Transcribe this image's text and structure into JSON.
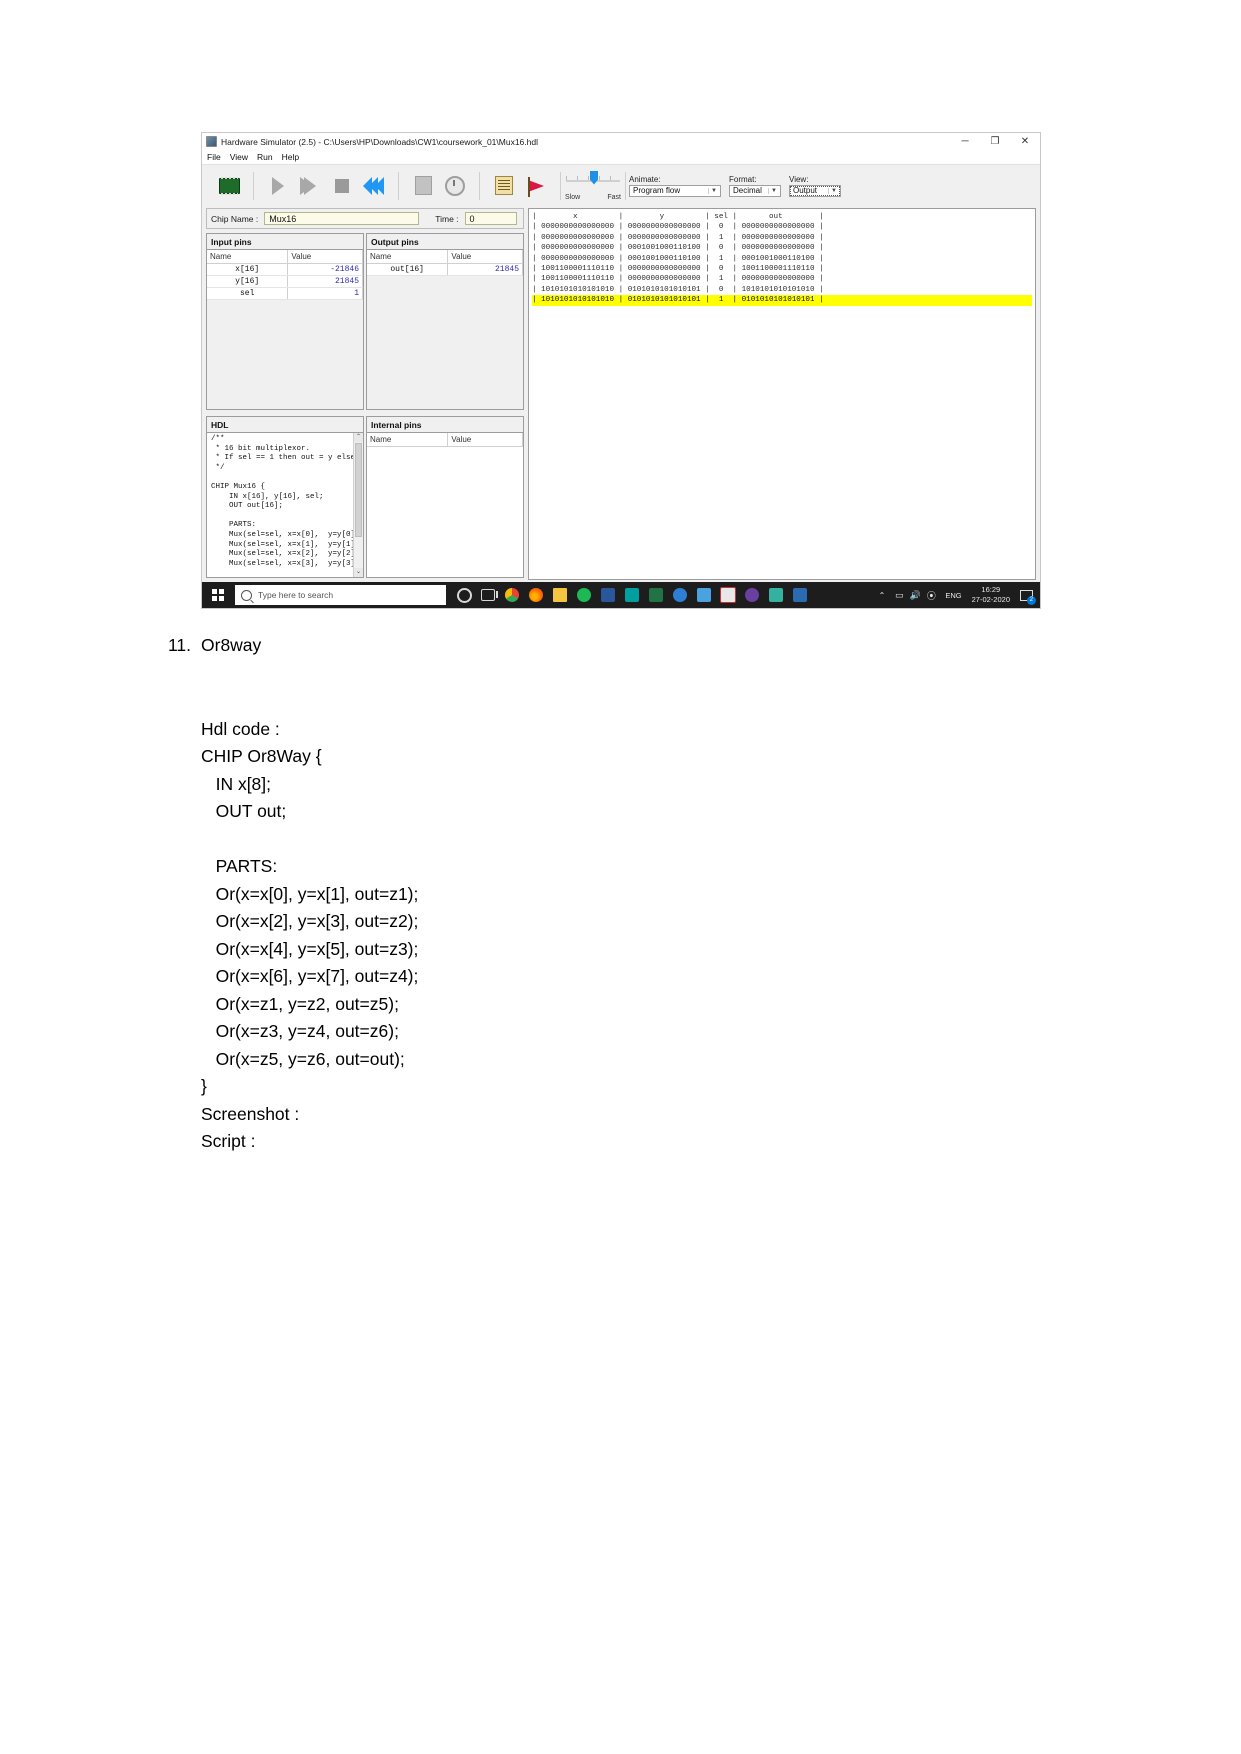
{
  "window": {
    "title": "Hardware Simulator (2.5) - C:\\Users\\HP\\Downloads\\CW1\\coursework_01\\Mux16.hdl",
    "icon": "chip-icon",
    "minimize": "─",
    "maximize": "❐",
    "close": "✕",
    "menus": [
      "File",
      "View",
      "Run",
      "Help"
    ]
  },
  "toolbar": {
    "buttons": [
      {
        "name": "load-chip-icon",
        "label": "Load Chip"
      },
      {
        "name": "single-step-icon",
        "label": "Single Step"
      },
      {
        "name": "run-icon",
        "label": "Run"
      },
      {
        "name": "stop-icon",
        "label": "Stop"
      },
      {
        "name": "rewind-icon",
        "label": "Rewind"
      },
      {
        "name": "load-script-icon",
        "label": "Load Script"
      },
      {
        "name": "clock-icon",
        "label": "Clock"
      },
      {
        "name": "script-icon",
        "label": "Script"
      },
      {
        "name": "breakpoints-icon",
        "label": "Breakpoints"
      }
    ],
    "speed": {
      "slow_label": "Slow",
      "fast_label": "Fast",
      "position_percent": 50
    },
    "animate": {
      "label": "Animate:",
      "value": "Program flow"
    },
    "format": {
      "label": "Format:",
      "value": "Decimal"
    },
    "view": {
      "label": "View:",
      "value": "Output"
    }
  },
  "chip": {
    "name_label": "Chip Name :",
    "name_value": "Mux16",
    "time_label": "Time :",
    "time_value": "0"
  },
  "input_pins": {
    "title": "Input pins",
    "columns": [
      "Name",
      "Value"
    ],
    "rows": [
      {
        "name": "x[16]",
        "value": "-21846"
      },
      {
        "name": "y[16]",
        "value": "21845"
      },
      {
        "name": "sel",
        "value": "1"
      }
    ]
  },
  "output_pins": {
    "title": "Output pins",
    "columns": [
      "Name",
      "Value"
    ],
    "rows": [
      {
        "name": "out[16]",
        "value": "21845"
      }
    ]
  },
  "internal_pins": {
    "title": "Internal pins",
    "columns": [
      "Name",
      "Value"
    ],
    "rows": []
  },
  "hdl": {
    "title": "HDL",
    "code": "/**\n * 16 bit multiplexor.\n * If sel == 1 then out = y else\n */\n\nCHIP Mux16 {\n    IN x[16], y[16], sel;\n    OUT out[16];\n\n    PARTS:\n    Mux(sel=sel, x=x[0],  y=y[0]\n    Mux(sel=sel, x=x[1],  y=y[1]\n    Mux(sel=sel, x=x[2],  y=y[2]\n    Mux(sel=sel, x=x[3],  y=y[3]",
    "scroll_up": "⌃",
    "scroll_down": "⌄"
  },
  "simulation": {
    "header": "|        x         |        y         | sel |       out        |",
    "rows": [
      "| 0000000000000000 | 0000000000000000 |  0  | 0000000000000000 |",
      "| 0000000000000000 | 0000000000000000 |  1  | 0000000000000000 |",
      "| 0000000000000000 | 0001001000110100 |  0  | 0000000000000000 |",
      "| 0000000000000000 | 0001001000110100 |  1  | 0001001000110100 |",
      "| 1001100001110110 | 0000000000000000 |  0  | 1001100001110110 |",
      "| 1001100001110110 | 0000000000000000 |  1  | 0000000000000000 |",
      "| 1010101010101010 | 0101010101010101 |  0  | 1010101010101010 |",
      "| 1010101010101010 | 0101010101010101 |  1  | 0101010101010101 |"
    ],
    "highlighted_row_index": 7,
    "highlight_color": "#ffff00"
  },
  "taskbar": {
    "start_label": "Start",
    "search_placeholder": "Type here to search",
    "apps": [
      {
        "name": "cortana-icon"
      },
      {
        "name": "task-view-icon"
      },
      {
        "name": "chrome-icon"
      },
      {
        "name": "firefox-icon"
      },
      {
        "name": "file-explorer-icon"
      },
      {
        "name": "browser-globe-icon"
      },
      {
        "name": "word-icon"
      },
      {
        "name": "webex-icon"
      },
      {
        "name": "excel-icon"
      },
      {
        "name": "edge-icon"
      },
      {
        "name": "photos-icon"
      },
      {
        "name": "pdf-icon"
      },
      {
        "name": "settings-icon"
      },
      {
        "name": "teams-icon"
      },
      {
        "name": "store-icon"
      }
    ],
    "tray": {
      "chevron": "⌃",
      "battery": "▭",
      "volume": "🔊",
      "network": "⦿",
      "language": "ENG",
      "time": "16:29",
      "date": "27-02-2020",
      "notification_badge": "2"
    }
  },
  "document": {
    "item_number": "11.",
    "item_title": "Or8way",
    "lines": [
      "",
      "Hdl code :",
      "CHIP Or8Way {",
      "   IN x[8];",
      "   OUT out;",
      "",
      "   PARTS:",
      "   Or(x=x[0], y=x[1], out=z1);",
      "   Or(x=x[2], y=x[3], out=z2);",
      "   Or(x=x[4], y=x[5], out=z3);",
      "   Or(x=x[6], y=x[7], out=z4);",
      "   Or(x=z1, y=z2, out=z5);",
      "   Or(x=z3, y=z4, out=z6);",
      "   Or(x=z5, y=z6, out=out);",
      "}",
      "Screenshot :",
      "Script :"
    ]
  }
}
